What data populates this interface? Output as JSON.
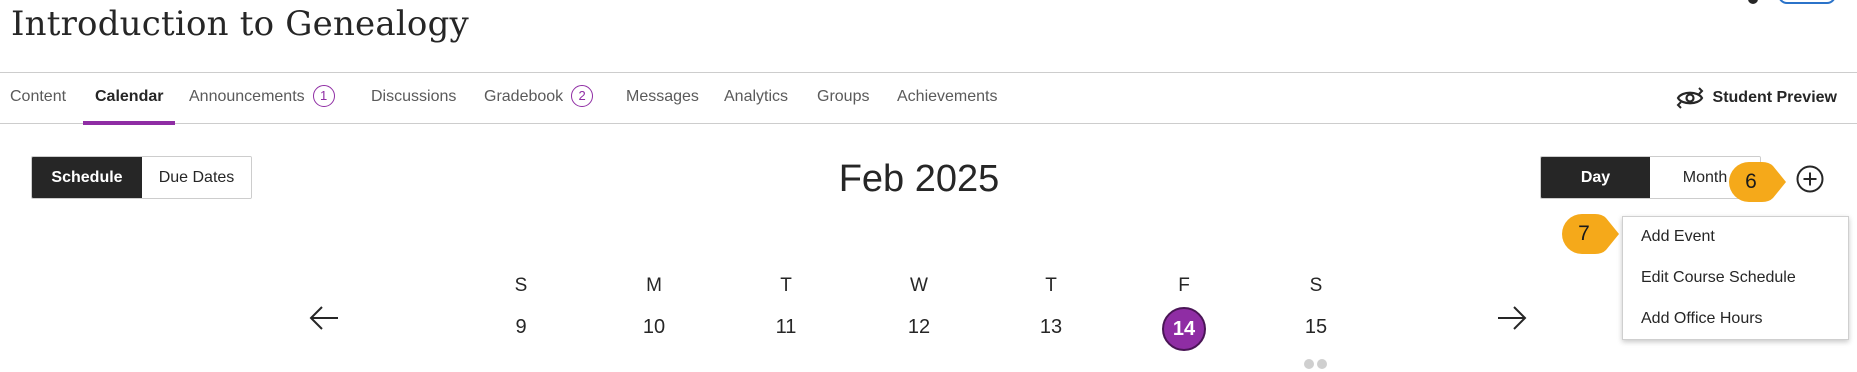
{
  "course": {
    "title": "Introduction to Genealogy"
  },
  "nav": {
    "tabs": [
      {
        "label": "Content"
      },
      {
        "label": "Calendar",
        "active": true
      },
      {
        "label": "Announcements",
        "badge": "1"
      },
      {
        "label": "Discussions"
      },
      {
        "label": "Gradebook",
        "badge": "2"
      },
      {
        "label": "Messages"
      },
      {
        "label": "Analytics"
      },
      {
        "label": "Groups"
      },
      {
        "label": "Achievements"
      }
    ],
    "student_preview": {
      "label": "Student Preview",
      "icon": "eye-refresh-icon"
    }
  },
  "calendar": {
    "view_toggle": {
      "schedule": "Schedule",
      "due_dates": "Due Dates",
      "selected": "Schedule"
    },
    "range_toggle": {
      "day": "Day",
      "month": "Month",
      "selected": "Day"
    },
    "month_label": "Feb 2025",
    "add_icon": "plus-circle-icon",
    "add_menu": {
      "items": [
        "Add Event",
        "Edit Course Schedule",
        "Add Office Hours"
      ]
    },
    "week": {
      "letters": [
        "S",
        "M",
        "T",
        "W",
        "T",
        "F",
        "S"
      ],
      "days": [
        "9",
        "10",
        "11",
        "12",
        "13",
        "14",
        "15"
      ],
      "today": "14"
    },
    "prev_icon": "arrow-left-icon",
    "next_icon": "arrow-right-icon"
  },
  "callouts": {
    "step6": "6",
    "step7": "7",
    "color": "#f5a91a"
  },
  "colors": {
    "accent": "#8f2da4",
    "dark": "#262626",
    "link": "#2b73c9"
  }
}
